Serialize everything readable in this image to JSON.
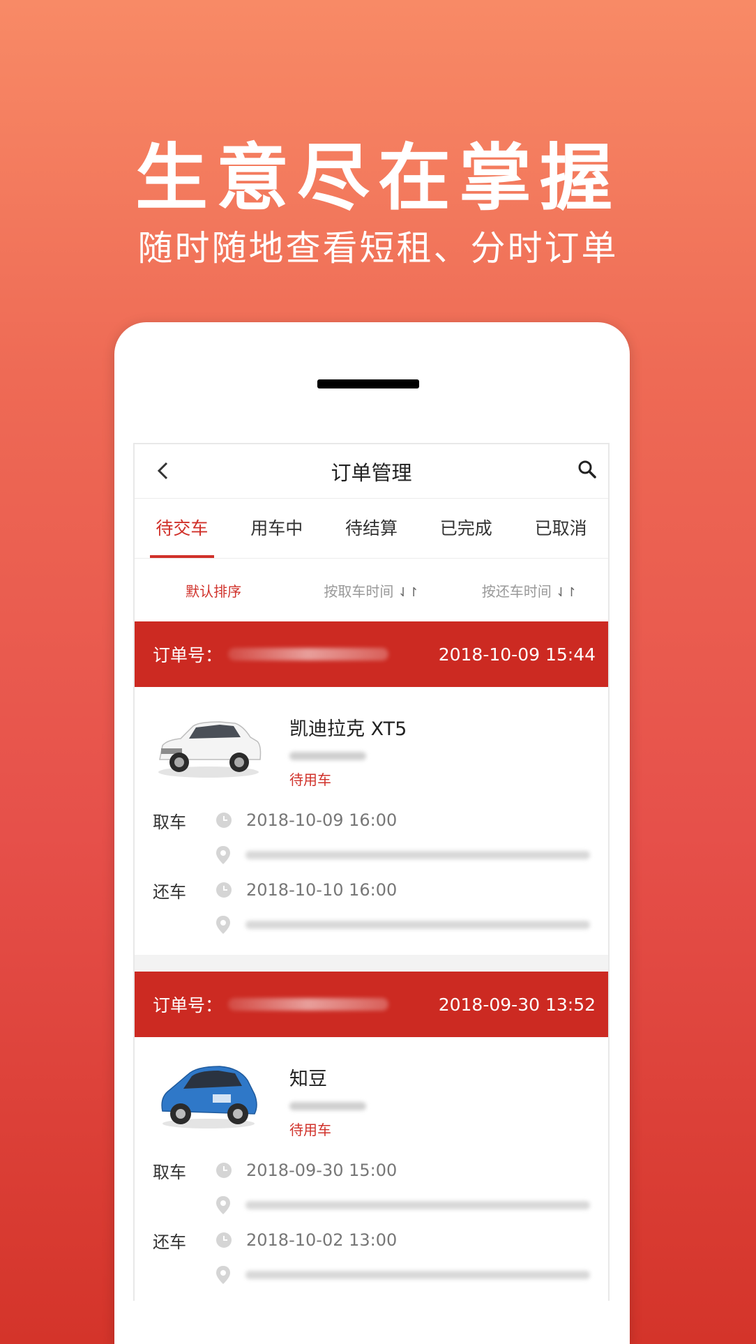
{
  "headline": "生意尽在掌握",
  "subline": "随时随地查看短租、分时订单",
  "app": {
    "title": "订单管理",
    "tabs": [
      {
        "label": "待交车",
        "active": true
      },
      {
        "label": "用车中",
        "active": false
      },
      {
        "label": "待结算",
        "active": false
      },
      {
        "label": "已完成",
        "active": false
      },
      {
        "label": "已取消",
        "active": false
      }
    ],
    "sort": {
      "default": "默认排序",
      "pickup": "按取车时间",
      "return": "按还车时间",
      "arrows": "⇃↾"
    },
    "orders": [
      {
        "order_label": "订单号：",
        "time": "2018-10-09 15:44",
        "car_name": "凯迪拉克 XT5",
        "car_status": "待用车",
        "car_color": "#eeeeee",
        "pickup_label": "取车",
        "pickup_time": "2018-10-09 16:00",
        "return_label": "还车",
        "return_time": "2018-10-10 16:00"
      },
      {
        "order_label": "订单号：",
        "time": "2018-09-30 13:52",
        "car_name": "知豆",
        "car_status": "待用车",
        "car_color": "#2f78c8",
        "pickup_label": "取车",
        "pickup_time": "2018-09-30 15:00",
        "return_label": "还车",
        "return_time": "2018-10-02 13:00"
      }
    ]
  },
  "colors": {
    "accent": "#d0312a",
    "header_bg": "#cc2a22"
  }
}
